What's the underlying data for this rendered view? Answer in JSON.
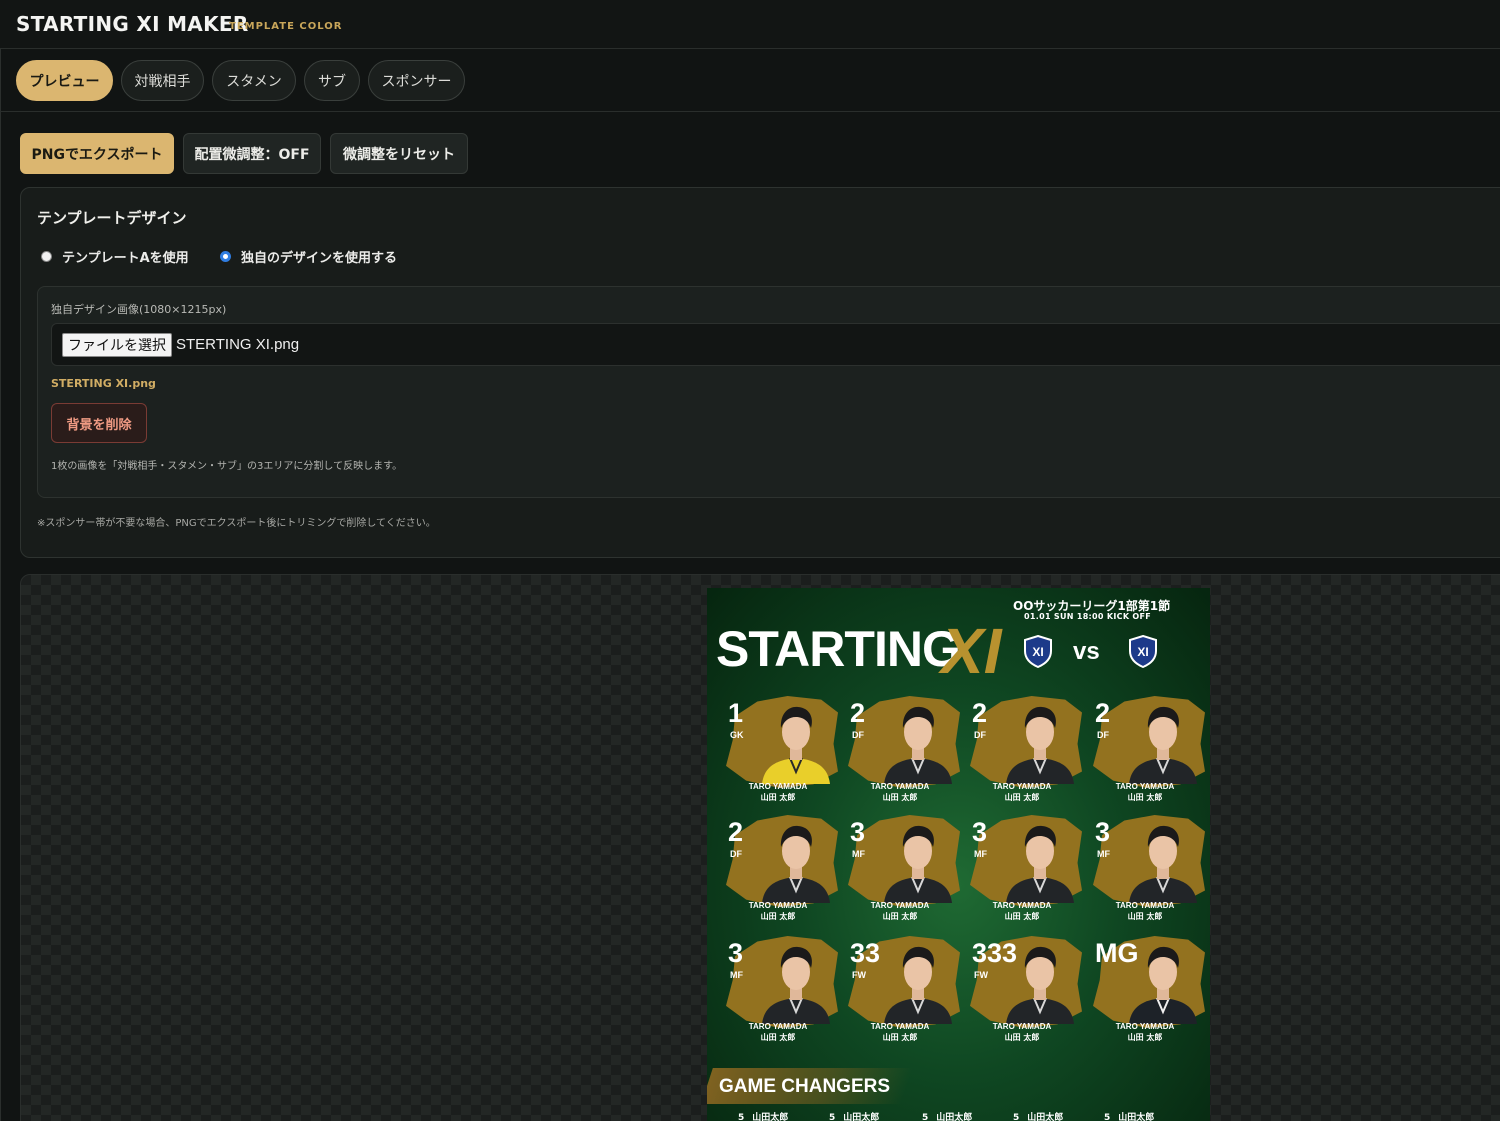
{
  "app": {
    "title": "STARTING XI MAKER",
    "subtitle": "TEMPLATE COLOR"
  },
  "tabs": [
    {
      "label": "プレビュー",
      "active": true
    },
    {
      "label": "対戦相手",
      "active": false
    },
    {
      "label": "スタメン",
      "active": false
    },
    {
      "label": "サブ",
      "active": false
    },
    {
      "label": "スポンサー",
      "active": false
    }
  ],
  "toolbar": {
    "export_label": "PNGでエクスポート",
    "adjust_label": "配置微調整：OFF",
    "reset_label": "微調整をリセット"
  },
  "template_panel": {
    "title": "テンプレートデザイン",
    "options": [
      {
        "label": "テンプレートAを使用",
        "selected": false
      },
      {
        "label": "独自のデザインを使用する",
        "selected": true
      }
    ],
    "image_label": "独自デザイン画像(1080×1215px)",
    "file_button": "ファイルを選択",
    "file_name": "STERTING XI.png",
    "current_file": "STERTING XI.png",
    "remove_bg_label": "背景を削除",
    "help": "1枚の画像を「対戦相手・スタメン・サブ」の3エリアに分割して反映します。",
    "note": "※スポンサー帯が不要な場合、PNGでエクスポート後にトリミングで削除してください。"
  },
  "poster": {
    "league": "OOサッカーリーグ1部第1節",
    "kickoff": "01.01 SUN 18:00 KICK OFF",
    "title_main": "STARTING",
    "title_xi": "XI",
    "crest_text": "XI",
    "vs": "vs",
    "players": [
      {
        "number": "1",
        "position": "GK",
        "name_en": "TARO YAMADA",
        "name_jp": "山田 太郎",
        "kit": "gk"
      },
      {
        "number": "2",
        "position": "DF",
        "name_en": "TARO YAMADA",
        "name_jp": "山田 太郎",
        "kit": "field"
      },
      {
        "number": "2",
        "position": "DF",
        "name_en": "TARO YAMADA",
        "name_jp": "山田 太郎",
        "kit": "field"
      },
      {
        "number": "2",
        "position": "DF",
        "name_en": "TARO YAMADA",
        "name_jp": "山田 太郎",
        "kit": "field"
      },
      {
        "number": "2",
        "position": "DF",
        "name_en": "TARO YAMADA",
        "name_jp": "山田 太郎",
        "kit": "field"
      },
      {
        "number": "3",
        "position": "MF",
        "name_en": "TARO YAMADA",
        "name_jp": "山田 太郎",
        "kit": "field"
      },
      {
        "number": "3",
        "position": "MF",
        "name_en": "TARO YAMADA",
        "name_jp": "山田 太郎",
        "kit": "field"
      },
      {
        "number": "3",
        "position": "MF",
        "name_en": "TARO YAMADA",
        "name_jp": "山田 太郎",
        "kit": "field"
      },
      {
        "number": "3",
        "position": "MF",
        "name_en": "TARO YAMADA",
        "name_jp": "山田 太郎",
        "kit": "field"
      },
      {
        "number": "33",
        "position": "FW",
        "name_en": "TARO YAMADA",
        "name_jp": "山田 太郎",
        "kit": "field"
      },
      {
        "number": "333",
        "position": "FW",
        "name_en": "TARO YAMADA",
        "name_jp": "山田 太郎",
        "kit": "field"
      },
      {
        "number": "MG",
        "position": "",
        "name_en": "TARO YAMADA",
        "name_jp": "山田 太郎",
        "kit": "suit"
      }
    ],
    "game_changers_title": "GAME CHANGERS",
    "subs": [
      {
        "number": "5",
        "name": "山田太郎"
      },
      {
        "number": "5",
        "name": "山田太郎"
      },
      {
        "number": "5",
        "name": "山田太郎"
      },
      {
        "number": "5",
        "name": "山田太郎"
      },
      {
        "number": "5",
        "name": "山田太郎"
      }
    ]
  },
  "colors": {
    "accent": "#dbb670",
    "accent_text": "#c9a65a",
    "background": "#111413",
    "danger": "#ef9a83",
    "radio_selected": "#2f7de1",
    "poster_green": "#0f4722",
    "poster_gold": "#93721f"
  }
}
